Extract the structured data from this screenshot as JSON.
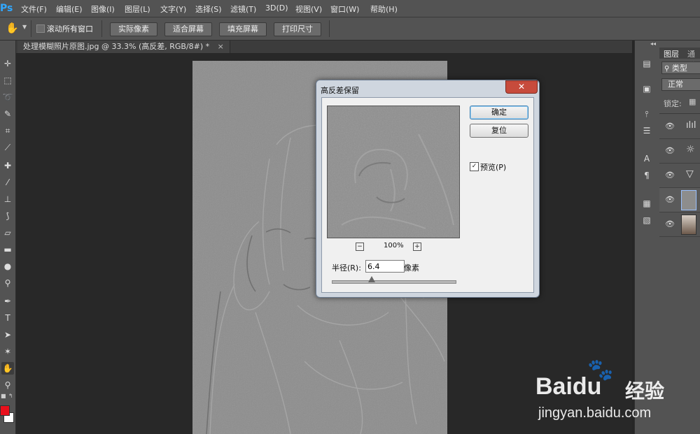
{
  "app": {
    "logo": "Ps"
  },
  "menu": [
    "文件(F)",
    "编辑(E)",
    "图像(I)",
    "图层(L)",
    "文字(Y)",
    "选择(S)",
    "滤镜(T)",
    "3D(D)",
    "视图(V)",
    "窗口(W)",
    "帮助(H)"
  ],
  "options": {
    "scroll_all_label": "滚动所有窗口",
    "buttons": [
      "实际像素",
      "适合屏幕",
      "填充屏幕",
      "打印尺寸"
    ]
  },
  "document": {
    "tab_title": "处理模糊照片原图.jpg @ 33.3% (高反差, RGB/8#) *"
  },
  "layers_panel": {
    "tabs": [
      "图层",
      "通道"
    ],
    "filter_label": "类型",
    "blend_mode": "正常",
    "lock_label": "锁定:"
  },
  "dialog": {
    "title": "高反差保留",
    "ok": "确定",
    "reset": "复位",
    "preview_label": "预览(P)",
    "zoom": "100%",
    "radius_label": "半径(R):",
    "radius_value": "6.4",
    "unit": "像素",
    "radius_slider_fraction": 0.32
  },
  "watermark": {
    "brand": "Baidu",
    "service": "经验",
    "url": "jingyan.baidu.com"
  },
  "colors": {
    "foreground": "#e8101c",
    "background": "#ffffff",
    "accent": "#31a8ff"
  }
}
